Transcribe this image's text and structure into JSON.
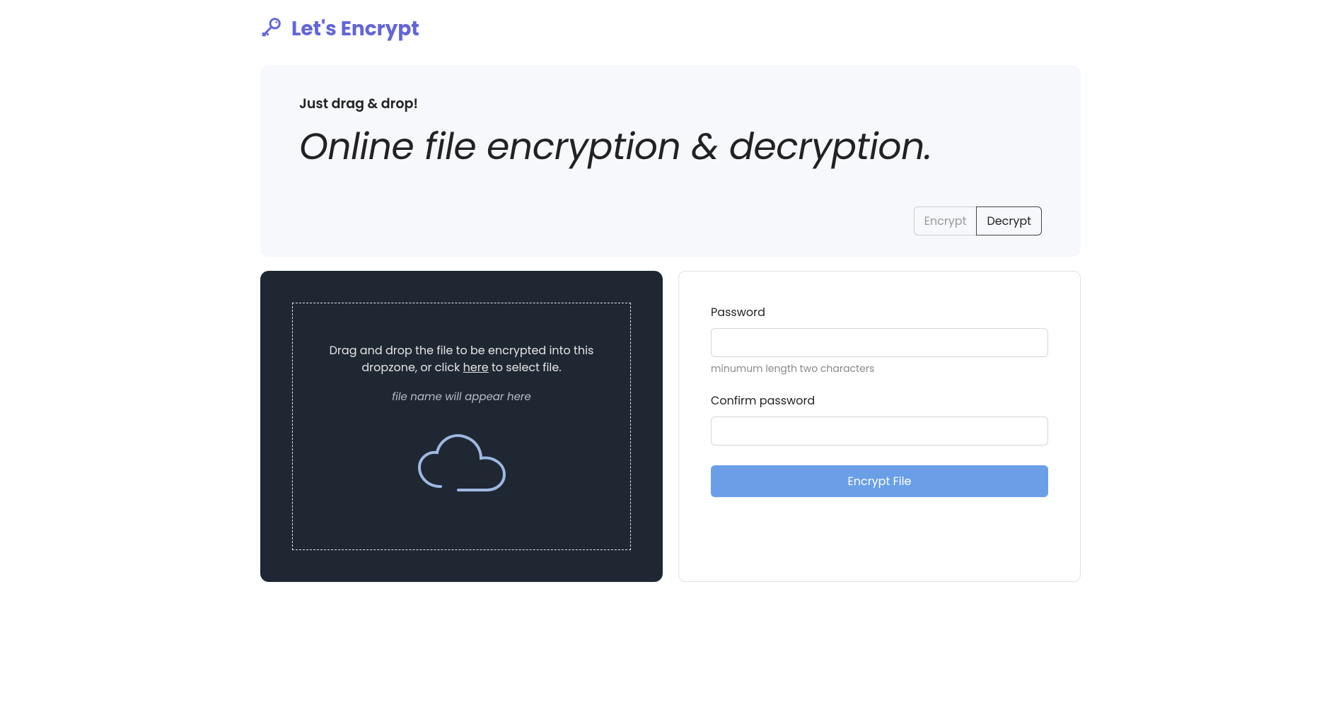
{
  "brand": {
    "name": "Let's Encrypt"
  },
  "hero": {
    "subtitle": "Just drag & drop!",
    "title": "Online file encryption & decryption."
  },
  "tabs": {
    "encrypt": "Encrypt",
    "decrypt": "Decrypt"
  },
  "dropzone": {
    "text_before": "Drag and drop the file to be encrypted into this dropzone, or click ",
    "link": "here",
    "text_after": " to select file.",
    "filename_placeholder": "file name will appear here"
  },
  "form": {
    "password_label": "Password",
    "password_hint": "minumum length two characters",
    "confirm_label": "Confirm password",
    "submit_label": "Encrypt File"
  }
}
